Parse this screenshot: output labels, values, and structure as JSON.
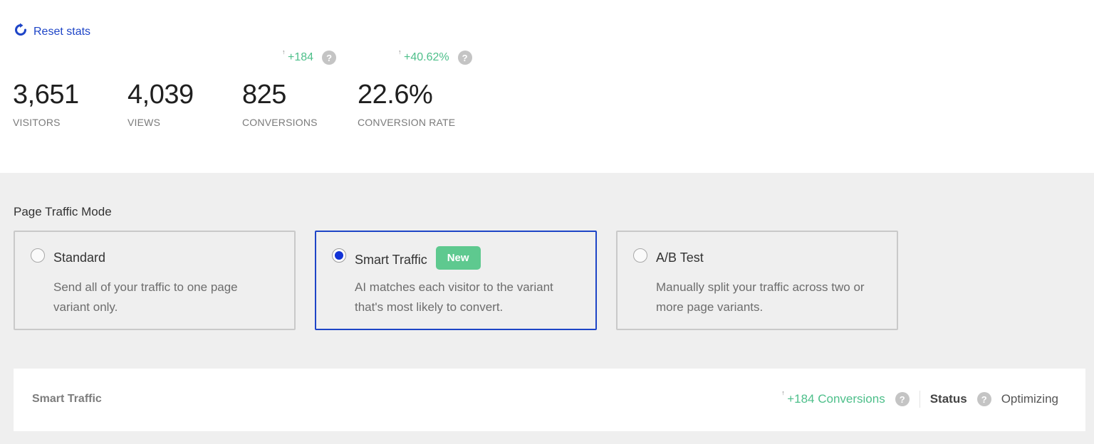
{
  "header": {
    "reset_label": "Reset stats",
    "reset_icon": "refresh-icon"
  },
  "stats": [
    {
      "value": "3,651",
      "label": "VISITORS"
    },
    {
      "value": "4,039",
      "label": "VIEWS"
    },
    {
      "value": "825",
      "label": "CONVERSIONS",
      "delta": "+184",
      "delta_arrow": "↑"
    },
    {
      "value": "22.6%",
      "label": "CONVERSION RATE",
      "delta": "+40.62%",
      "delta_arrow": "↑"
    }
  ],
  "help_glyph": "?",
  "traffic_mode": {
    "title": "Page Traffic Mode",
    "options": [
      {
        "title": "Standard",
        "description": "Send all of your traffic to one page variant only.",
        "selected": false
      },
      {
        "title": "Smart Traffic",
        "badge": "New",
        "description": "AI matches each visitor to the variant that's most likely to convert.",
        "selected": true
      },
      {
        "title": "A/B Test",
        "description": "Manually split your traffic across two or more page variants.",
        "selected": false
      }
    ]
  },
  "panel": {
    "title": "Smart Traffic",
    "conversions": "+184 Conversions",
    "conversions_arrow": "↑",
    "status_label": "Status",
    "status_value": "Optimizing"
  },
  "colors": {
    "accent": "#1e45c7",
    "positive": "#4dbf8a",
    "badge": "#5ec98f",
    "background": "#efefef"
  }
}
